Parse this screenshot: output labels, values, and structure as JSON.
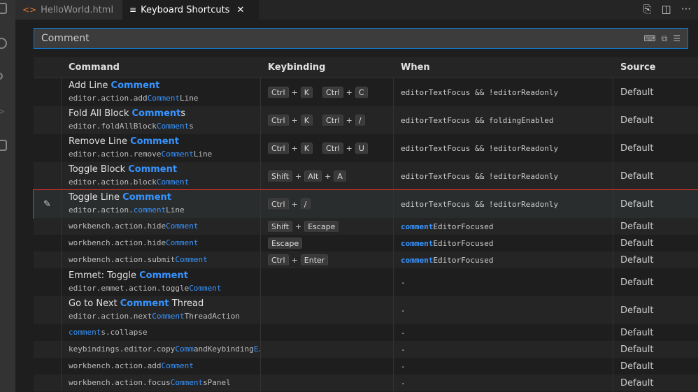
{
  "tabs": [
    {
      "label": "HelloWorld.html",
      "icon": "html-code-icon"
    },
    {
      "label": "Keyboard Shortcuts",
      "icon": "keyboard-shortcuts-icon",
      "active": true
    }
  ],
  "search": {
    "value": "Comment"
  },
  "headers": {
    "command": "Command",
    "keybinding": "Keybinding",
    "when": "When",
    "source": "Source"
  },
  "rows": [
    {
      "title": [
        [
          "Add Line ",
          0
        ],
        [
          "Comment",
          1
        ]
      ],
      "cmd": [
        [
          "editor.action.add",
          0
        ],
        [
          "Comment",
          1
        ],
        [
          "Line",
          0
        ]
      ],
      "keys": [
        [
          "Ctrl",
          "K"
        ],
        [
          "Ctrl",
          "C"
        ]
      ],
      "when": [
        [
          "editorTextFocus && !editorReadonly",
          0
        ]
      ],
      "source": "Default"
    },
    {
      "title": [
        [
          "Fold All Block ",
          0
        ],
        [
          "Comment",
          1
        ],
        [
          "s",
          0
        ]
      ],
      "cmd": [
        [
          "editor.foldAllBlock",
          0
        ],
        [
          "Comment",
          1
        ],
        [
          "s",
          0
        ]
      ],
      "keys": [
        [
          "Ctrl",
          "K"
        ],
        [
          "Ctrl",
          "/"
        ]
      ],
      "when": [
        [
          "editorTextFocus && foldingEnabled",
          0
        ]
      ],
      "source": "Default"
    },
    {
      "title": [
        [
          "Remove Line ",
          0
        ],
        [
          "Comment",
          1
        ]
      ],
      "cmd": [
        [
          "editor.action.remove",
          0
        ],
        [
          "Comment",
          1
        ],
        [
          "Line",
          0
        ]
      ],
      "keys": [
        [
          "Ctrl",
          "K"
        ],
        [
          "Ctrl",
          "U"
        ]
      ],
      "when": [
        [
          "editorTextFocus && !editorReadonly",
          0
        ]
      ],
      "source": "Default"
    },
    {
      "title": [
        [
          "Toggle Block ",
          0
        ],
        [
          "Comment",
          1
        ]
      ],
      "cmd": [
        [
          "editor.action.block",
          0
        ],
        [
          "Comment",
          1
        ]
      ],
      "keys": [
        [
          "Shift",
          "Alt",
          "A"
        ]
      ],
      "when": [
        [
          "editorTextFocus && !editorReadonly",
          0
        ]
      ],
      "source": "Default"
    },
    {
      "title": [
        [
          "Toggle Line ",
          0
        ],
        [
          "Comment",
          1
        ]
      ],
      "cmd": [
        [
          "editor.action.",
          0
        ],
        [
          "comment",
          1
        ],
        [
          "Line",
          0
        ]
      ],
      "keys": [
        [
          "Ctrl",
          "/"
        ]
      ],
      "when": [
        [
          "editorTextFocus && !editorReadonly",
          0
        ]
      ],
      "source": "Default",
      "selected": true
    },
    {
      "cmd": [
        [
          "workbench.action.hide",
          0
        ],
        [
          "Comment",
          1
        ]
      ],
      "keys": [
        [
          "Shift",
          "Escape"
        ]
      ],
      "when": [
        [
          "comment",
          1
        ],
        [
          "EditorFocused",
          0
        ]
      ],
      "source": "Default"
    },
    {
      "cmd": [
        [
          "workbench.action.hide",
          0
        ],
        [
          "Comment",
          1
        ]
      ],
      "keys": [
        [
          "Escape"
        ]
      ],
      "when": [
        [
          "comment",
          1
        ],
        [
          "EditorFocused",
          0
        ]
      ],
      "source": "Default"
    },
    {
      "cmd": [
        [
          "workbench.action.submit",
          0
        ],
        [
          "Comment",
          1
        ]
      ],
      "keys": [
        [
          "Ctrl",
          "Enter"
        ]
      ],
      "when": [
        [
          "comment",
          1
        ],
        [
          "EditorFocused",
          0
        ]
      ],
      "source": "Default"
    },
    {
      "title": [
        [
          "Emmet: Toggle ",
          0
        ],
        [
          "Comment",
          1
        ]
      ],
      "cmd": [
        [
          "editor.emmet.action.toggle",
          0
        ],
        [
          "Comment",
          1
        ]
      ],
      "keys": [],
      "when": [
        [
          "-",
          0
        ]
      ],
      "source": "Default"
    },
    {
      "title": [
        [
          "Go to Next ",
          0
        ],
        [
          "Comment",
          1
        ],
        [
          " Thread",
          0
        ]
      ],
      "cmd": [
        [
          "editor.action.next",
          0
        ],
        [
          "Comment",
          1
        ],
        [
          "ThreadAction",
          0
        ]
      ],
      "keys": [],
      "when": [
        [
          "-",
          0
        ]
      ],
      "source": "Default"
    },
    {
      "cmd": [
        [
          "comment",
          1
        ],
        [
          "s.collapse",
          0
        ]
      ],
      "keys": [],
      "when": [
        [
          "-",
          0
        ]
      ],
      "source": "Default"
    },
    {
      "cmd": [
        [
          "keybindings.editor.copy",
          0
        ],
        [
          "Comm",
          1
        ],
        [
          "andKeybinding",
          0
        ],
        [
          "E…",
          1
        ]
      ],
      "keys": [],
      "when": [
        [
          "-",
          0
        ]
      ],
      "source": "Default"
    },
    {
      "cmd": [
        [
          "workbench.action.add",
          0
        ],
        [
          "Comment",
          1
        ]
      ],
      "keys": [],
      "when": [
        [
          "-",
          0
        ]
      ],
      "source": "Default"
    },
    {
      "cmd": [
        [
          "workbench.action.focus",
          0
        ],
        [
          "Comment",
          1
        ],
        [
          "sPanel",
          0
        ]
      ],
      "keys": [],
      "when": [
        [
          "-",
          0
        ]
      ],
      "source": "Default"
    }
  ]
}
